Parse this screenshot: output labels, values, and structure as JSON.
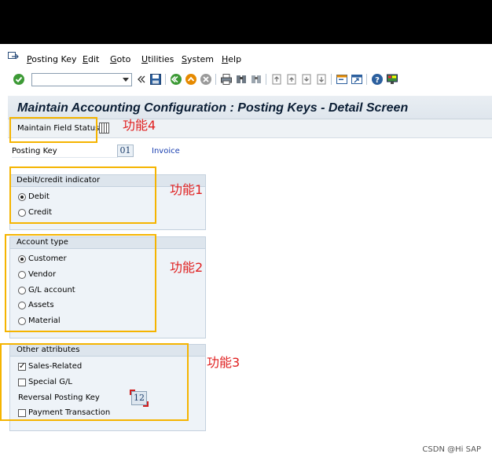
{
  "menubar": {
    "items": [
      "Posting Key",
      "Edit",
      "Goto",
      "Utilities",
      "System",
      "Help"
    ]
  },
  "toolbar": {
    "command_field_value": "",
    "icons": [
      "ok-icon",
      "back-icon",
      "save-icon",
      "back-nav-icon",
      "exit-icon",
      "cancel-icon",
      "print-icon",
      "find-icon",
      "find-next-icon",
      "first-page-icon",
      "prev-page-icon",
      "next-page-icon",
      "last-page-icon",
      "new-session-icon",
      "shortcut-icon",
      "help-icon",
      "layout-icon"
    ]
  },
  "screen": {
    "title": "Maintain Accounting Configuration : Posting Keys - Detail Screen",
    "app_button": "Maintain Field Status"
  },
  "posting_key": {
    "label": "Posting Key",
    "value": "01",
    "description": "Invoice"
  },
  "debit_credit": {
    "title": "Debit/credit indicator",
    "options": [
      "Debit",
      "Credit"
    ],
    "selected": "Debit"
  },
  "account_type": {
    "title": "Account type",
    "options": [
      "Customer",
      "Vendor",
      "G/L account",
      "Assets",
      "Material"
    ],
    "selected": "Customer"
  },
  "other_attributes": {
    "title": "Other attributes",
    "sales_related": "Sales-Related",
    "sales_related_checked": true,
    "special_gl": "Special G/L",
    "special_gl_checked": false,
    "reversal_label": "Reversal Posting Key",
    "reversal_value": "12",
    "payment_transaction": "Payment Transaction",
    "payment_transaction_checked": false
  },
  "annotations": {
    "a1": "功能1",
    "a2": "功能2",
    "a3": "功能3",
    "a4": "功能4"
  },
  "watermark": "CSDN @Hi SAP",
  "colors": {
    "highlight": "#f5b400",
    "annotation": "#e02020",
    "title": "#0b1e35"
  }
}
